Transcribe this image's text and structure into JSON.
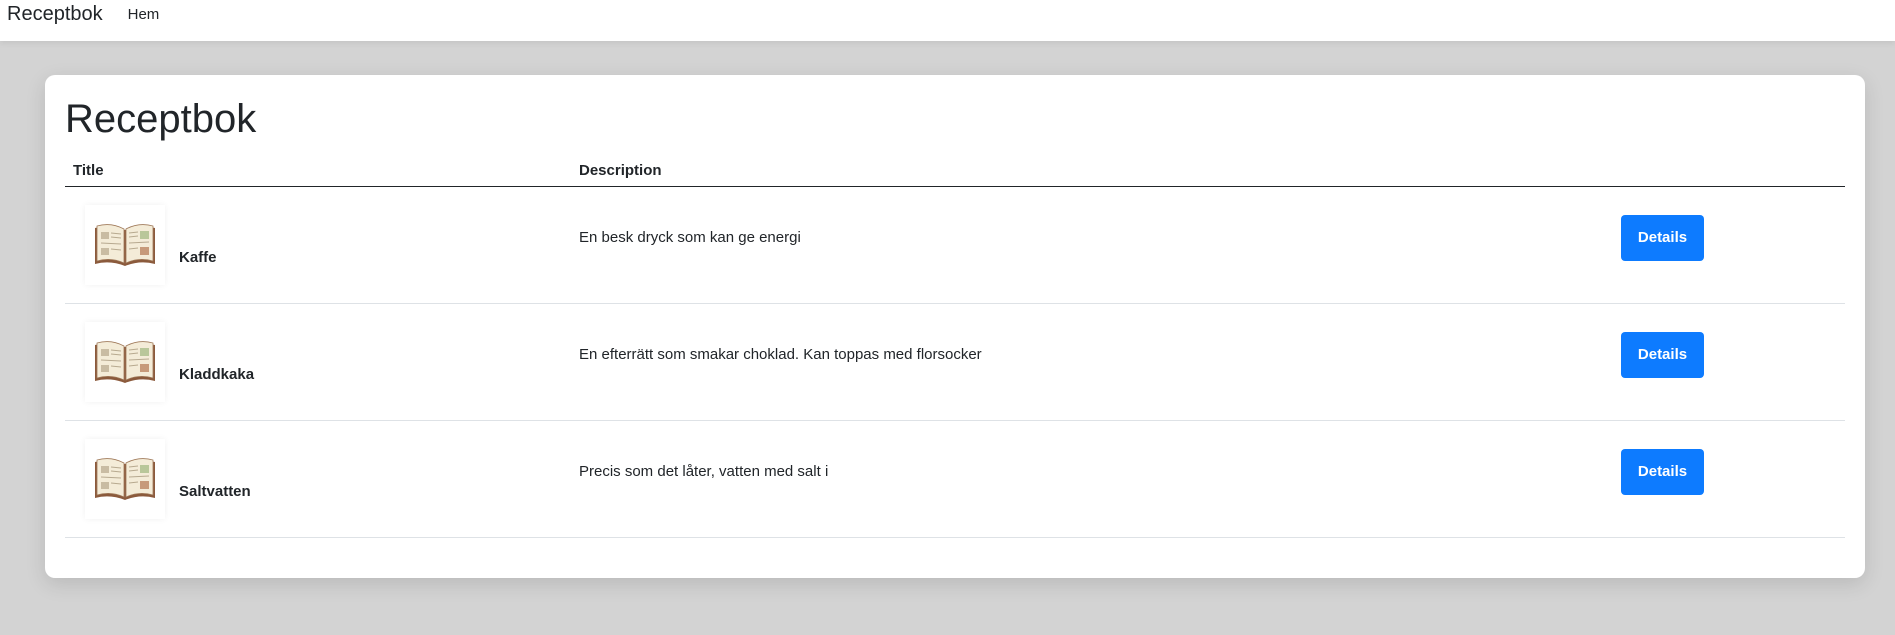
{
  "navbar": {
    "brand": "Receptbok",
    "links": [
      {
        "label": "Hem"
      }
    ]
  },
  "main": {
    "title": "Receptbok",
    "table": {
      "columns": [
        "Title",
        "Description"
      ],
      "rows": [
        {
          "icon": "open-book-icon",
          "title": "Kaffe",
          "description": "En besk dryck som kan ge energi",
          "action_label": "Details"
        },
        {
          "icon": "open-book-icon",
          "title": "Kladdkaka",
          "description": "En efterrätt som smakar choklad. Kan toppas med florsocker",
          "action_label": "Details"
        },
        {
          "icon": "open-book-icon",
          "title": "Saltvatten",
          "description": "Precis som det låter, vatten med salt i",
          "action_label": "Details"
        }
      ]
    }
  },
  "colors": {
    "primary_button": "#0d7bff",
    "page_background": "#d3d3d3",
    "card_background": "#ffffff",
    "text": "#212529"
  }
}
